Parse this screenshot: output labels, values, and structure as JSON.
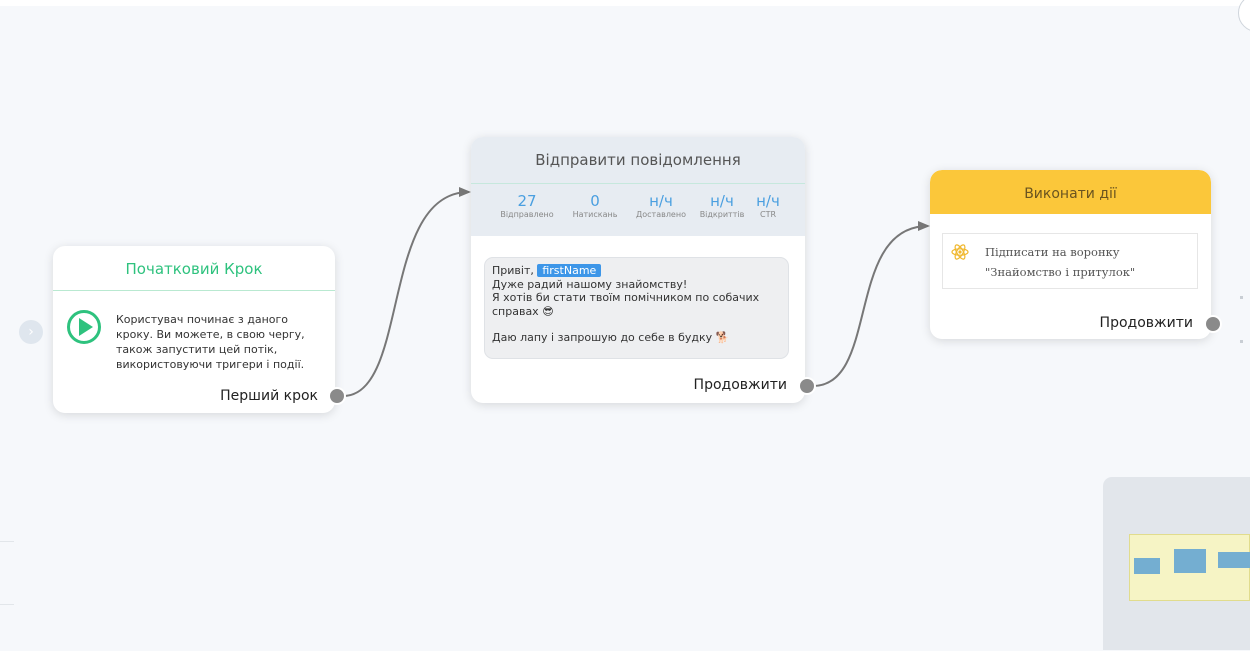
{
  "start_node": {
    "title": "Початковий Крок",
    "description": "Користувач починає з даного кроку. Ви можете, в свою чергу, також запустити цей потік, використовуючи тригери і події.",
    "footer_label": "Перший крок",
    "icon": "play-circle-icon"
  },
  "message_node": {
    "title": "Відправити повідомлення",
    "stats": [
      {
        "value": "27",
        "label": "Відправлено"
      },
      {
        "value": "0",
        "label": "Натискань"
      },
      {
        "value": "н/ч",
        "label": "Доставлено"
      },
      {
        "value": "н/ч",
        "label": "Відкриттів"
      },
      {
        "value": "н/ч",
        "label": "CTR"
      }
    ],
    "message": {
      "greeting": "Привіт,",
      "variable": "firstName",
      "line2": "Дуже радий нашому знайомству!",
      "line3": "Я хотів би стати твоїм помічником по собачих справах 😎",
      "line4": "Даю лапу і запрошую до себе в будку 🐕"
    },
    "footer_label": "Продовжити"
  },
  "action_node": {
    "title": "Виконати дії",
    "action_text": "Підписати на воронку \"Знайомство і притулок\"",
    "action_icon": "atom-icon",
    "footer_label": "Продовжити"
  },
  "colors": {
    "start_accent": "#2ec27e",
    "action_header": "#fbc73a",
    "stat_value": "#4a9fe0",
    "variable_chip": "#3d96e8"
  }
}
